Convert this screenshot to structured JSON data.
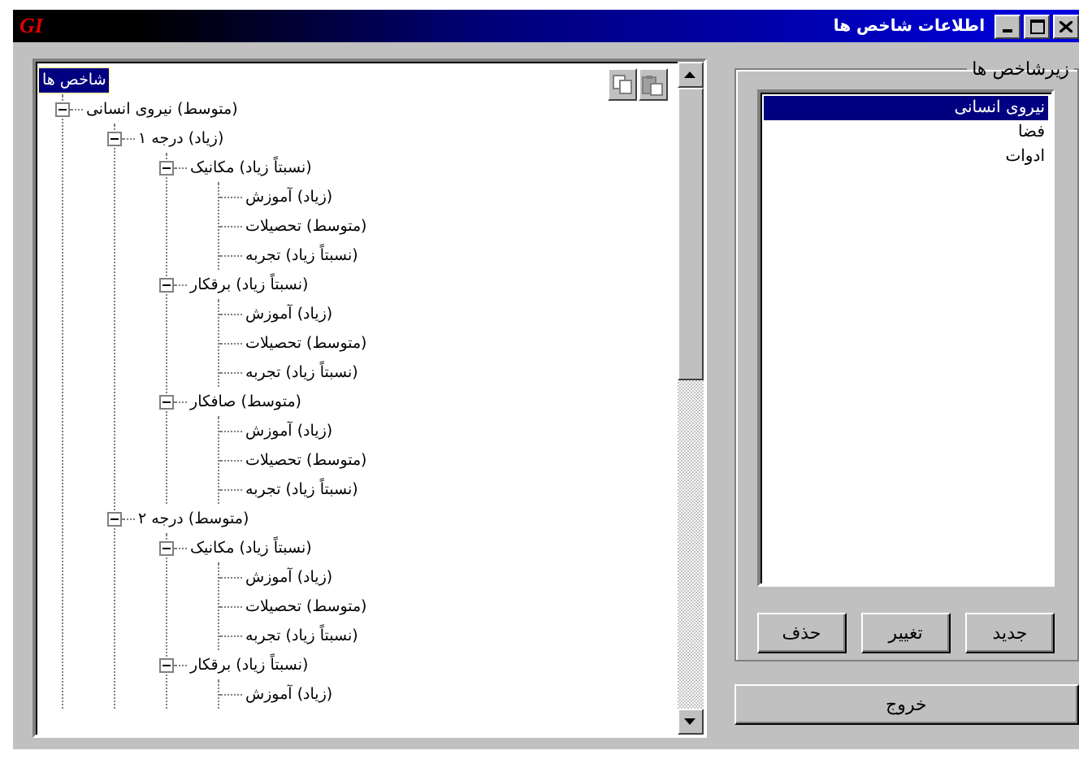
{
  "window": {
    "title": "اطلاعات شاخص ها",
    "logo": "GI"
  },
  "tree": {
    "label": "شاخص ها",
    "selected": true,
    "children": [
      {
        "label": "(متوسط) نیروی انسانی",
        "selected": false,
        "expanded": true,
        "children": [
          {
            "label": "(زیاد) درجه ۱",
            "selected": false,
            "expanded": true,
            "children": [
              {
                "label": "(نسبتاً زیاد) مکانیک",
                "selected": false,
                "expanded": true,
                "children": [
                  {
                    "label": "(زیاد) آموزش",
                    "selected": false
                  },
                  {
                    "label": "(متوسط) تحصیلات",
                    "selected": false
                  },
                  {
                    "label": "(نسبتاً زیاد) تجربه",
                    "selected": false
                  }
                ]
              },
              {
                "label": "(نسبتاً زیاد) برقکار",
                "selected": false,
                "expanded": true,
                "children": [
                  {
                    "label": "(زیاد) آموزش",
                    "selected": false
                  },
                  {
                    "label": "(متوسط) تحصیلات",
                    "selected": false
                  },
                  {
                    "label": "(نسبتاً زیاد) تجربه",
                    "selected": false
                  }
                ]
              },
              {
                "label": "(متوسط) صافکار",
                "selected": false,
                "expanded": true,
                "children": [
                  {
                    "label": "(زیاد) آموزش",
                    "selected": false
                  },
                  {
                    "label": "(متوسط) تحصیلات",
                    "selected": false
                  },
                  {
                    "label": "(نسبتاً زیاد) تجربه",
                    "selected": false
                  }
                ]
              }
            ]
          },
          {
            "label": "(متوسط) درجه ۲",
            "selected": false,
            "expanded": true,
            "children": [
              {
                "label": "(نسبتاً زیاد) مکانیک",
                "selected": false,
                "expanded": true,
                "children": [
                  {
                    "label": "(زیاد) آموزش",
                    "selected": false
                  },
                  {
                    "label": "(متوسط) تحصیلات",
                    "selected": false
                  },
                  {
                    "label": "(نسبتاً زیاد) تجربه",
                    "selected": false
                  }
                ]
              },
              {
                "label": "(نسبتاً زیاد) برقکار",
                "selected": false,
                "expanded": true,
                "children": [
                  {
                    "label": "(زیاد) آموزش",
                    "selected": false
                  }
                ]
              }
            ]
          }
        ]
      }
    ]
  },
  "subindicators": {
    "title": "زیرشاخص ها",
    "items": [
      {
        "label": "نیروی انسانی",
        "selected": true
      },
      {
        "label": "فضا",
        "selected": false
      },
      {
        "label": "ادوات",
        "selected": false
      }
    ],
    "buttons": [
      "جدید",
      "تغییر",
      "حذف"
    ]
  },
  "exit_button": "خروج"
}
